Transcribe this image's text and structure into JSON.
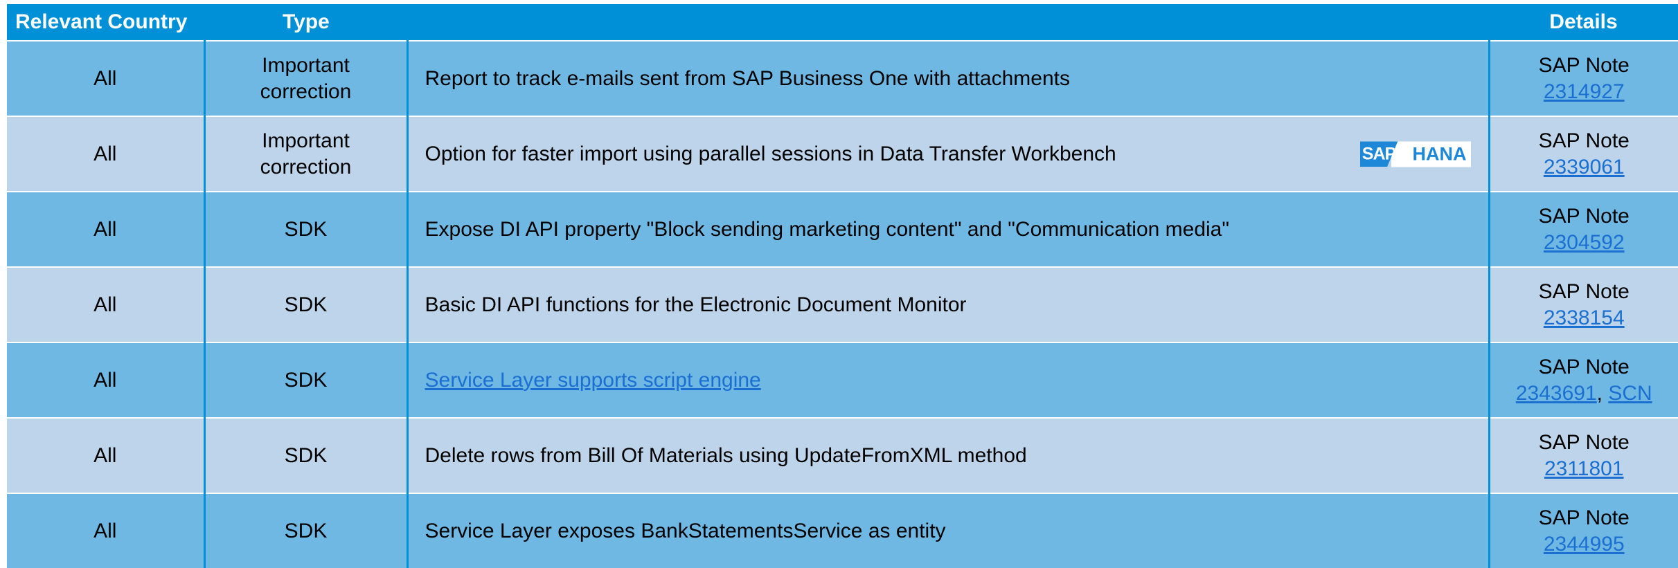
{
  "header": {
    "country": "Relevant Country",
    "type": "Type",
    "description": "",
    "details": "Details"
  },
  "rows": [
    {
      "country": "All",
      "type_line1": "Important",
      "type_line2": "correction",
      "description": "Report to track e-mails sent from SAP Business One with attachments",
      "details_label": "SAP Note",
      "note": "2314927"
    },
    {
      "country": "All",
      "type_line1": "Important",
      "type_line2": "correction",
      "description": "Option for faster import using parallel sessions in Data Transfer Workbench",
      "details_label": "SAP Note",
      "note": "2339061",
      "logo_sap": "SAP",
      "logo_hana": "HANA"
    },
    {
      "country": "All",
      "type": "SDK",
      "description": "Expose DI API property \"Block sending marketing content\" and \"Communication media\"",
      "details_label": "SAP Note",
      "note": "2304592"
    },
    {
      "country": "All",
      "type": "SDK",
      "description": "Basic DI API functions for the Electronic Document Monitor",
      "details_label": "SAP Note",
      "note": "2338154"
    },
    {
      "country": "All",
      "type": "SDK",
      "description": "Service Layer supports script engine",
      "details_label": "SAP Note",
      "note": "2343691",
      "separator": ", ",
      "extra_link": "SCN"
    },
    {
      "country": "All",
      "type": "SDK",
      "description": "Delete rows from Bill Of Materials using UpdateFromXML method",
      "details_label": "SAP Note",
      "note": "2311801"
    },
    {
      "country": "All",
      "type": "SDK",
      "description": "Service Layer exposes BankStatementsService as entity",
      "details_label": "SAP Note",
      "note": "2344995"
    }
  ],
  "colors": {
    "header_bg": "#0090d8",
    "row_dark": "#6fb8e3",
    "row_light": "#bdd4ea",
    "link": "#1a6fd1"
  }
}
